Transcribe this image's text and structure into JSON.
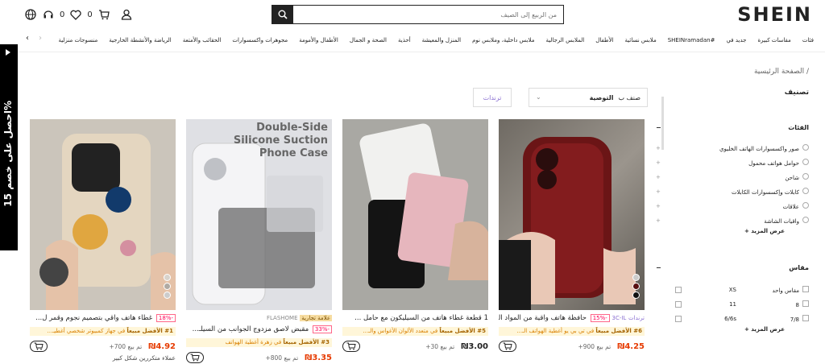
{
  "header": {
    "logo": "SHEIN",
    "search_placeholder": "من الربيع إلى الصيف",
    "bag_count": "0",
    "wishlist_count": "0"
  },
  "nav": {
    "items": [
      "فئات",
      "مقاسات كبيرة",
      "جديد في",
      "SHEINramadan#",
      "ملابس نسائية",
      "الأطفال",
      "الملابس الرجالية",
      "ملابس داخلية، وملابس نوم",
      "المنزل والمعيشة",
      "أحذية",
      "الصحة و الجمال",
      "الأطفال والأمومة",
      "مجوهرات واكسسوارات",
      "الحقائب والأمتعة",
      "الرياضة والأنشطة الخارجية",
      "منسوجات منزلية"
    ]
  },
  "promo": {
    "text": "احصل على خصم 15%"
  },
  "breadcrumb": {
    "home": "الصفحة الرئيسية",
    "sep": "/"
  },
  "filters": {
    "title": "تصنيف",
    "sort_label": "صنف ب",
    "sort_value": "التوصية",
    "trends_button": "ترندات",
    "categories": {
      "heading": "الفئات",
      "items": [
        "صور واكسسوارات الهاتف الخليوي",
        "حوامل هواتف محمول",
        "شاحن",
        "كابلات وإكسسوارات الكابلات",
        "علاقات",
        "واقيات الشاشة"
      ],
      "more": "عرض المزيد"
    },
    "size": {
      "heading": "مقاس",
      "items_right": [
        "مقاس واحد",
        "8",
        "7/8"
      ],
      "items_left": [
        "XS",
        "11",
        "6/6s"
      ],
      "more": "عرض المزيد"
    }
  },
  "products": [
    {
      "title": "حافظة هاتف واقية من المواد البرغندية...",
      "discount": "-15%",
      "tag": "ترندات",
      "store": "3C-IL",
      "rank": "#6 الأفضل مبيعاً",
      "rank_in": "في تي بي يو أغطية الهواتف الـ...",
      "price": "4.25",
      "sold": "تم بيع 900+",
      "currency": "₪"
    },
    {
      "title": "1 قطعة غطاء هاتف من السيليكون مع حامل ...",
      "discount": "",
      "tag": "",
      "store": "",
      "rank": "#5 الأفضل مبيعاً",
      "rank_in": "في متعدد الألوان الأغواس والـ...",
      "price": "3.00",
      "sold": "تم بيع 30+",
      "currency": "₪"
    },
    {
      "title": "مقبض لاصق مزدوج الجوانب من السيلـ...",
      "discount": "-33%",
      "tag": "علامة تجارية",
      "store": "FLASHOME",
      "rank": "#3 الأفضل مبيعاً",
      "rank_in": "في زهرة أغطية الهواتف",
      "price": "3.35",
      "sold": "تم بيع 800+",
      "currency": "₪"
    },
    {
      "title": "غطاء هاتف واقي بتصميم نجوم وقمر ل...",
      "discount": "-18%",
      "tag": "",
      "store": "",
      "rank": "#1 الأفضل مبيعاً",
      "rank_in": "في جهاز كمبيوتر شخصي أغطيـ...",
      "price": "4.92",
      "sold": "تم بيع 700+",
      "currency": "₪",
      "extra": "عملاء متكررين شكل كبير"
    }
  ],
  "image_text": {
    "case_ad": [
      "Double-Side",
      "Silicone Suction",
      "Phone Case"
    ]
  }
}
